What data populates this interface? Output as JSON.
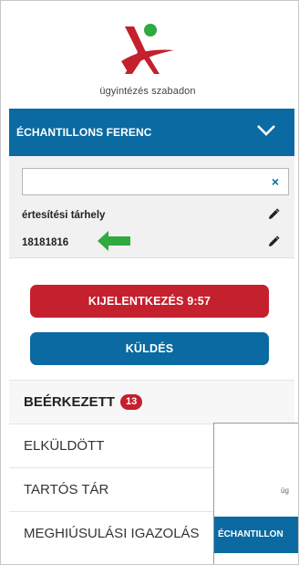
{
  "brand": {
    "tagline": "ügyintézés szabadon"
  },
  "user": {
    "name": "ÉCHANTILLONS FERENC"
  },
  "search": {
    "value": "",
    "clear_symbol": "×"
  },
  "account": {
    "storage_label": "értesítési tárhely",
    "id_value": "18181816"
  },
  "buttons": {
    "logout_label": "KIJELENTKEZÉS 9:57",
    "send_label": "KÜLDÉS"
  },
  "nav": {
    "items": [
      {
        "label": "BEÉRKEZETT",
        "badge": "13"
      },
      {
        "label": "ELKÜLDÖTT"
      },
      {
        "label": "TARTÓS TÁR"
      },
      {
        "label": "MEGHIÚSULÁSI IGAZOLÁS"
      }
    ]
  },
  "thumbnail": {
    "tagline_fragment": "üg",
    "user_fragment": "ÉCHANTILLON"
  },
  "colors": {
    "primary": "#0a6aa1",
    "danger": "#c4202d",
    "arrow": "#2eaa3f"
  }
}
